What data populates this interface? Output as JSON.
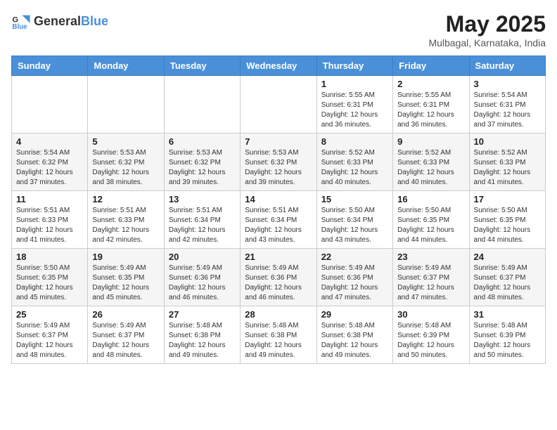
{
  "header": {
    "logo_general": "General",
    "logo_blue": "Blue",
    "month_title": "May 2025",
    "location": "Mulbagal, Karnataka, India"
  },
  "weekdays": [
    "Sunday",
    "Monday",
    "Tuesday",
    "Wednesday",
    "Thursday",
    "Friday",
    "Saturday"
  ],
  "weeks": [
    [
      {
        "day": "",
        "info": ""
      },
      {
        "day": "",
        "info": ""
      },
      {
        "day": "",
        "info": ""
      },
      {
        "day": "",
        "info": ""
      },
      {
        "day": "1",
        "info": "Sunrise: 5:55 AM\nSunset: 6:31 PM\nDaylight: 12 hours\nand 36 minutes."
      },
      {
        "day": "2",
        "info": "Sunrise: 5:55 AM\nSunset: 6:31 PM\nDaylight: 12 hours\nand 36 minutes."
      },
      {
        "day": "3",
        "info": "Sunrise: 5:54 AM\nSunset: 6:31 PM\nDaylight: 12 hours\nand 37 minutes."
      }
    ],
    [
      {
        "day": "4",
        "info": "Sunrise: 5:54 AM\nSunset: 6:32 PM\nDaylight: 12 hours\nand 37 minutes."
      },
      {
        "day": "5",
        "info": "Sunrise: 5:53 AM\nSunset: 6:32 PM\nDaylight: 12 hours\nand 38 minutes."
      },
      {
        "day": "6",
        "info": "Sunrise: 5:53 AM\nSunset: 6:32 PM\nDaylight: 12 hours\nand 39 minutes."
      },
      {
        "day": "7",
        "info": "Sunrise: 5:53 AM\nSunset: 6:32 PM\nDaylight: 12 hours\nand 39 minutes."
      },
      {
        "day": "8",
        "info": "Sunrise: 5:52 AM\nSunset: 6:33 PM\nDaylight: 12 hours\nand 40 minutes."
      },
      {
        "day": "9",
        "info": "Sunrise: 5:52 AM\nSunset: 6:33 PM\nDaylight: 12 hours\nand 40 minutes."
      },
      {
        "day": "10",
        "info": "Sunrise: 5:52 AM\nSunset: 6:33 PM\nDaylight: 12 hours\nand 41 minutes."
      }
    ],
    [
      {
        "day": "11",
        "info": "Sunrise: 5:51 AM\nSunset: 6:33 PM\nDaylight: 12 hours\nand 41 minutes."
      },
      {
        "day": "12",
        "info": "Sunrise: 5:51 AM\nSunset: 6:33 PM\nDaylight: 12 hours\nand 42 minutes."
      },
      {
        "day": "13",
        "info": "Sunrise: 5:51 AM\nSunset: 6:34 PM\nDaylight: 12 hours\nand 42 minutes."
      },
      {
        "day": "14",
        "info": "Sunrise: 5:51 AM\nSunset: 6:34 PM\nDaylight: 12 hours\nand 43 minutes."
      },
      {
        "day": "15",
        "info": "Sunrise: 5:50 AM\nSunset: 6:34 PM\nDaylight: 12 hours\nand 43 minutes."
      },
      {
        "day": "16",
        "info": "Sunrise: 5:50 AM\nSunset: 6:35 PM\nDaylight: 12 hours\nand 44 minutes."
      },
      {
        "day": "17",
        "info": "Sunrise: 5:50 AM\nSunset: 6:35 PM\nDaylight: 12 hours\nand 44 minutes."
      }
    ],
    [
      {
        "day": "18",
        "info": "Sunrise: 5:50 AM\nSunset: 6:35 PM\nDaylight: 12 hours\nand 45 minutes."
      },
      {
        "day": "19",
        "info": "Sunrise: 5:49 AM\nSunset: 6:35 PM\nDaylight: 12 hours\nand 45 minutes."
      },
      {
        "day": "20",
        "info": "Sunrise: 5:49 AM\nSunset: 6:36 PM\nDaylight: 12 hours\nand 46 minutes."
      },
      {
        "day": "21",
        "info": "Sunrise: 5:49 AM\nSunset: 6:36 PM\nDaylight: 12 hours\nand 46 minutes."
      },
      {
        "day": "22",
        "info": "Sunrise: 5:49 AM\nSunset: 6:36 PM\nDaylight: 12 hours\nand 47 minutes."
      },
      {
        "day": "23",
        "info": "Sunrise: 5:49 AM\nSunset: 6:37 PM\nDaylight: 12 hours\nand 47 minutes."
      },
      {
        "day": "24",
        "info": "Sunrise: 5:49 AM\nSunset: 6:37 PM\nDaylight: 12 hours\nand 48 minutes."
      }
    ],
    [
      {
        "day": "25",
        "info": "Sunrise: 5:49 AM\nSunset: 6:37 PM\nDaylight: 12 hours\nand 48 minutes."
      },
      {
        "day": "26",
        "info": "Sunrise: 5:49 AM\nSunset: 6:37 PM\nDaylight: 12 hours\nand 48 minutes."
      },
      {
        "day": "27",
        "info": "Sunrise: 5:48 AM\nSunset: 6:38 PM\nDaylight: 12 hours\nand 49 minutes."
      },
      {
        "day": "28",
        "info": "Sunrise: 5:48 AM\nSunset: 6:38 PM\nDaylight: 12 hours\nand 49 minutes."
      },
      {
        "day": "29",
        "info": "Sunrise: 5:48 AM\nSunset: 6:38 PM\nDaylight: 12 hours\nand 49 minutes."
      },
      {
        "day": "30",
        "info": "Sunrise: 5:48 AM\nSunset: 6:39 PM\nDaylight: 12 hours\nand 50 minutes."
      },
      {
        "day": "31",
        "info": "Sunrise: 5:48 AM\nSunset: 6:39 PM\nDaylight: 12 hours\nand 50 minutes."
      }
    ]
  ]
}
